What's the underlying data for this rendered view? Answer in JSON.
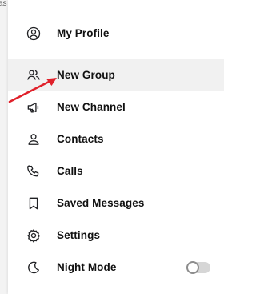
{
  "menu": {
    "items": [
      {
        "id": "my-profile",
        "label": "My Profile",
        "icon": "user-circle-icon",
        "active": false
      },
      {
        "id": "new-group",
        "label": "New Group",
        "icon": "users-icon",
        "active": true
      },
      {
        "id": "new-channel",
        "label": "New Channel",
        "icon": "megaphone-icon",
        "active": false
      },
      {
        "id": "contacts",
        "label": "Contacts",
        "icon": "person-icon",
        "active": false
      },
      {
        "id": "calls",
        "label": "Calls",
        "icon": "phone-icon",
        "active": false
      },
      {
        "id": "saved-messages",
        "label": "Saved Messages",
        "icon": "bookmark-icon",
        "active": false
      },
      {
        "id": "settings",
        "label": "Settings",
        "icon": "gear-icon",
        "active": false
      },
      {
        "id": "night-mode",
        "label": "Night Mode",
        "icon": "moon-icon",
        "active": false,
        "toggle": false
      }
    ]
  },
  "annotation": {
    "color": "#e0212b",
    "icon": "red-arrow-annotation-icon"
  },
  "colors": {
    "active_row": "#f1f1f1",
    "text": "#111111",
    "icon": "#202124",
    "toggle_track": "#d6d6d6",
    "toggle_knob_border": "#8d8d8d",
    "accent": "#3a8ee6"
  }
}
